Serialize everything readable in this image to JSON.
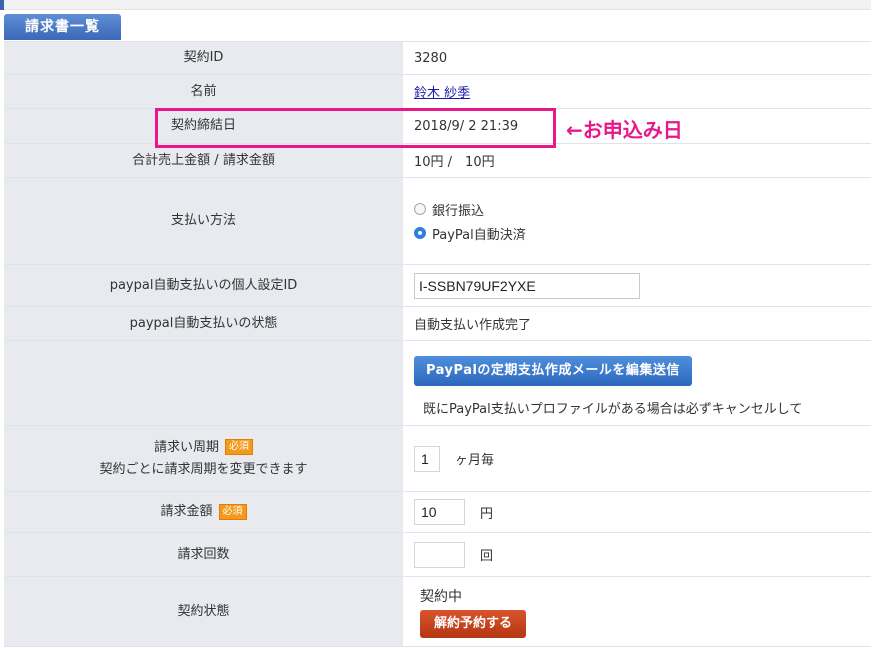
{
  "section": {
    "title": "請求書一覧"
  },
  "fields": {
    "contract_id": {
      "label": "契約ID",
      "value": "3280"
    },
    "name": {
      "label": "名前",
      "value": "鈴木 紗季"
    },
    "contract_date": {
      "label": "契約締結日",
      "value": "2018/9/ 2 21:39"
    },
    "amount": {
      "label": "合計売上金額 / 請求金額",
      "value": "10円 /　10円"
    },
    "payment": {
      "label": "支払い方法",
      "options": [
        {
          "label": "銀行振込",
          "selected": false
        },
        {
          "label": "PayPal自動決済",
          "selected": true
        }
      ]
    },
    "paypal_profile_id": {
      "label": "paypal自動支払いの個人設定ID",
      "value": "I-SSBN79UF2YXE"
    },
    "paypal_status": {
      "label": "paypal自動支払いの状態",
      "value": "自動支払い作成完了"
    },
    "paypal_mail": {
      "button": "PayPalの定期支払作成メールを編集送信",
      "note": "既にPayPal支払いプロファイルがある場合は必ずキャンセルして"
    },
    "billing_cycle": {
      "label": "請求い周期",
      "badge": "必須",
      "sublabel": "契約ごとに請求周期を変更できます",
      "value": "1",
      "unit": "ヶ月毎"
    },
    "billing_amount": {
      "label": "請求金額",
      "badge": "必須",
      "value": "10",
      "unit": "円"
    },
    "billing_count": {
      "label": "請求回数",
      "value": "",
      "unit": "回"
    },
    "contract_state": {
      "label": "契約状態",
      "value": "契約中",
      "button": "解約予約する"
    }
  },
  "annotation": {
    "text": "←お申込み日"
  },
  "colors": {
    "accent_blue": "#3b68b8",
    "highlight": "#e8178a",
    "danger": "#b43612",
    "required_badge": "#f39a1d"
  }
}
